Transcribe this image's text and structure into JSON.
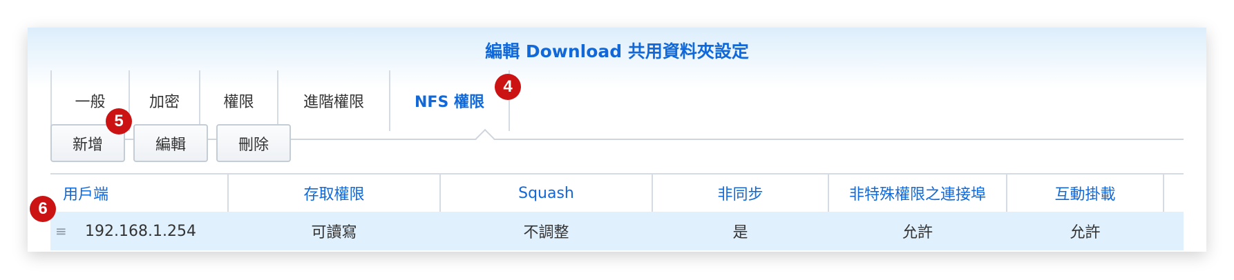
{
  "dialog": {
    "title": "編輯 Download 共用資料夾設定"
  },
  "tabs": [
    {
      "label": "一般"
    },
    {
      "label": "加密"
    },
    {
      "label": "權限"
    },
    {
      "label": "進階權限"
    },
    {
      "label": "NFS 權限",
      "active": true
    }
  ],
  "badges": {
    "tab": "4",
    "toolbar": "5",
    "row": "6"
  },
  "toolbar": {
    "add_label": "新增",
    "edit_label": "編輯",
    "delete_label": "刪除"
  },
  "table": {
    "columns": [
      "用戶端",
      "存取權限",
      "Squash",
      "非同步",
      "非特殊權限之連接埠",
      "互動掛載"
    ],
    "rows": [
      [
        "192.168.1.254",
        "可讀寫",
        "不調整",
        "是",
        "允許",
        "允許"
      ]
    ]
  },
  "colors": {
    "accent": "#1168d8",
    "badge": "#cc1313",
    "selected_row": "#e0f0fd"
  },
  "icons": {
    "drag_handle": "≡"
  }
}
